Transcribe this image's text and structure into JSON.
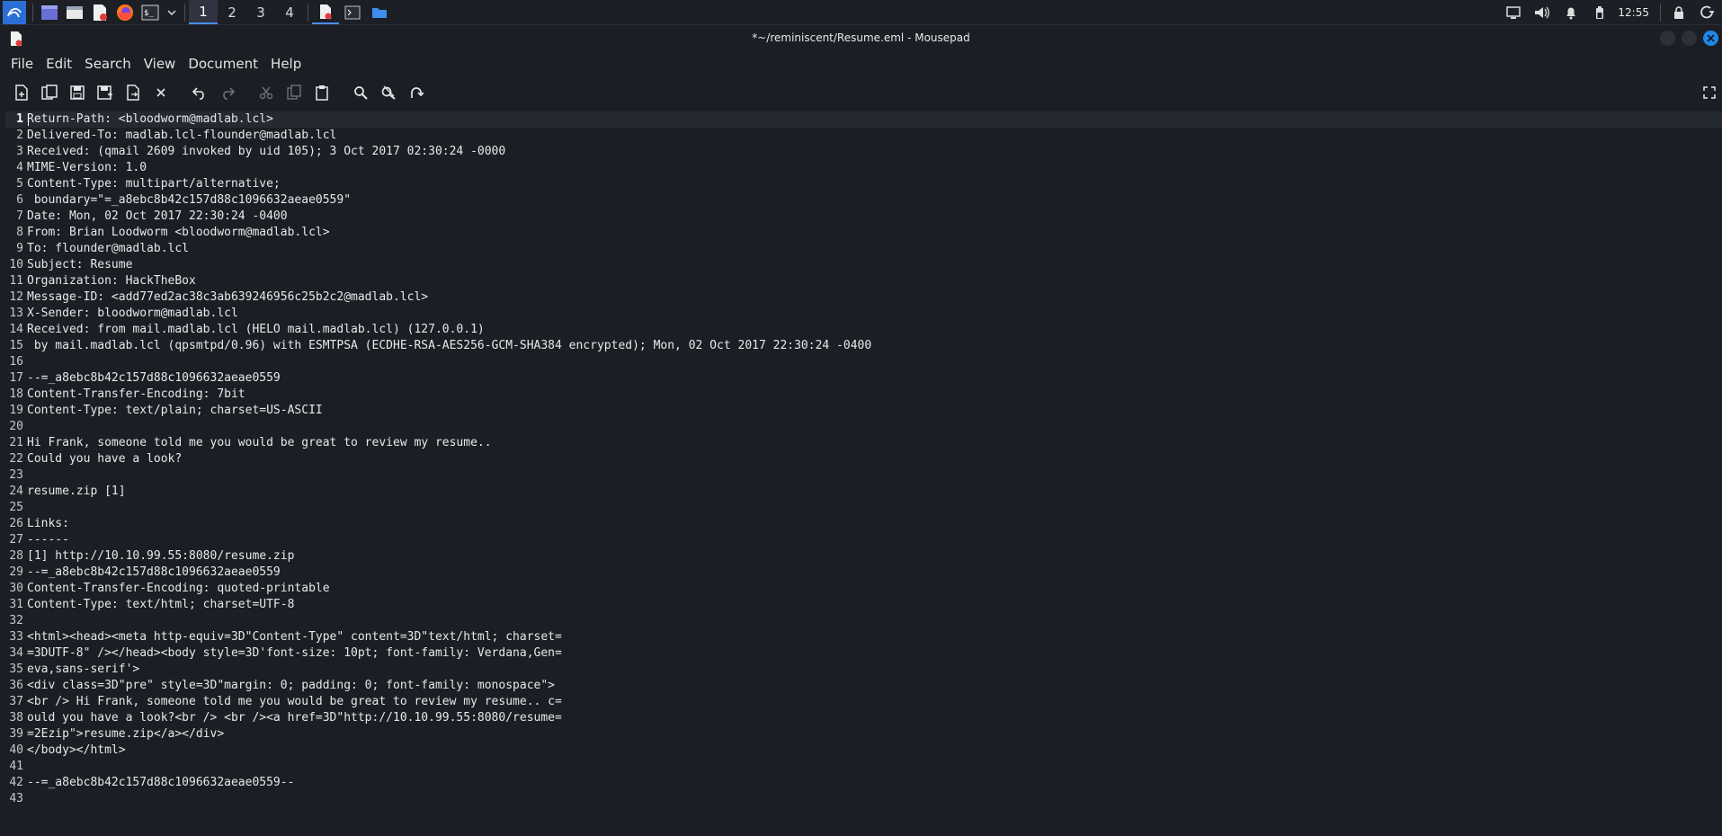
{
  "taskbar": {
    "workspaces": [
      "1",
      "2",
      "3",
      "4"
    ],
    "active_workspace": "1",
    "clock": "12:55"
  },
  "window": {
    "title": "*~/reminiscent/Resume.eml - Mousepad"
  },
  "menu": [
    "File",
    "Edit",
    "Search",
    "View",
    "Document",
    "Help"
  ],
  "toolbar_icons": [
    "new-document-icon",
    "new-window-icon",
    "save-icon",
    "save-as-icon",
    "reload-icon",
    "close-icon",
    "undo-icon",
    "redo-icon",
    "cut-icon",
    "copy-icon",
    "paste-icon",
    "find-icon",
    "find-replace-icon",
    "go-to-line-icon",
    "fullscreen-icon"
  ],
  "editor": {
    "current_line": 1,
    "lines": [
      "Return-Path: <bloodworm@madlab.lcl>",
      "Delivered-To: madlab.lcl-flounder@madlab.lcl",
      "Received: (qmail 2609 invoked by uid 105); 3 Oct 2017 02:30:24 -0000",
      "MIME-Version: 1.0",
      "Content-Type: multipart/alternative;",
      " boundary=\"=_a8ebc8b42c157d88c1096632aeae0559\"",
      "Date: Mon, 02 Oct 2017 22:30:24 -0400",
      "From: Brian Loodworm <bloodworm@madlab.lcl>",
      "To: flounder@madlab.lcl",
      "Subject: Resume",
      "Organization: HackTheBox",
      "Message-ID: <add77ed2ac38c3ab639246956c25b2c2@madlab.lcl>",
      "X-Sender: bloodworm@madlab.lcl",
      "Received: from mail.madlab.lcl (HELO mail.madlab.lcl) (127.0.0.1)",
      " by mail.madlab.lcl (qpsmtpd/0.96) with ESMTPSA (ECDHE-RSA-AES256-GCM-SHA384 encrypted); Mon, 02 Oct 2017 22:30:24 -0400",
      "",
      "--=_a8ebc8b42c157d88c1096632aeae0559",
      "Content-Transfer-Encoding: 7bit",
      "Content-Type: text/plain; charset=US-ASCII",
      "",
      "Hi Frank, someone told me you would be great to review my resume..",
      "Could you have a look?",
      "",
      "resume.zip [1]",
      "",
      "Links:",
      "------",
      "[1] http://10.10.99.55:8080/resume.zip",
      "--=_a8ebc8b42c157d88c1096632aeae0559",
      "Content-Transfer-Encoding: quoted-printable",
      "Content-Type: text/html; charset=UTF-8",
      "",
      "<html><head><meta http-equiv=3D\"Content-Type\" content=3D\"text/html; charset=",
      "=3DUTF-8\" /></head><body style=3D'font-size: 10pt; font-family: Verdana,Gen=",
      "eva,sans-serif'>",
      "<div class=3D\"pre\" style=3D\"margin: 0; padding: 0; font-family: monospace\">",
      "<br /> Hi Frank, someone told me you would be great to review my resume.. c=",
      "ould you have a look?<br /> <br /><a href=3D\"http://10.10.99.55:8080/resume=",
      "=2Ezip\">resume.zip</a></div>",
      "</body></html>",
      "",
      "--=_a8ebc8b42c157d88c1096632aeae0559--",
      ""
    ]
  },
  "colors": {
    "background": "#1b1e24",
    "accent": "#4b8ef0",
    "close_button": "#1e88e5"
  }
}
